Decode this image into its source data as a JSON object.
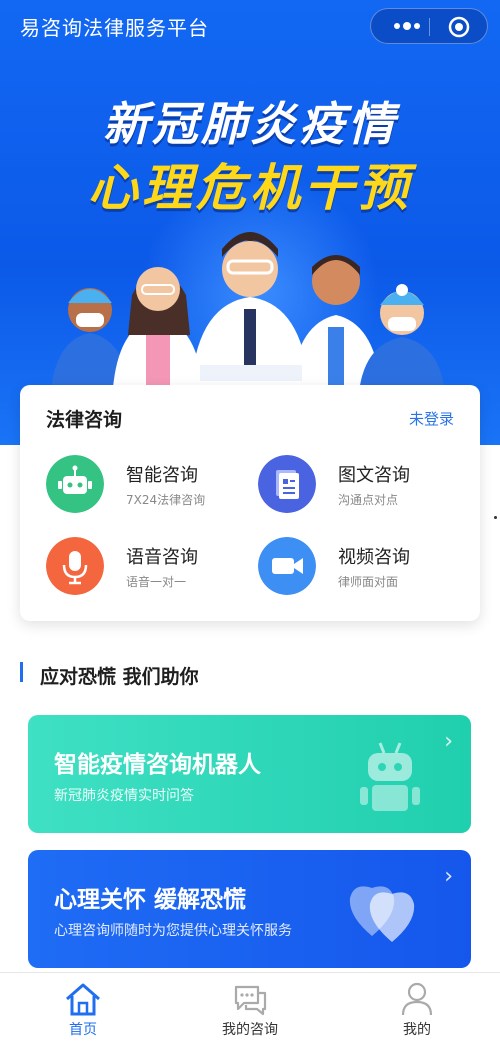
{
  "header": {
    "title": "易咨询法律服务平台",
    "more_icon": "more-dots-icon",
    "close_icon": "target-icon"
  },
  "hero": {
    "line1": "新冠肺炎疫情",
    "line2": "心理危机干预",
    "accent_color": "#ffd81a"
  },
  "legal_card": {
    "title": "法律咨询",
    "login_text": "未登录",
    "services": [
      {
        "title": "智能咨询",
        "subtitle": "7X24法律咨询",
        "icon": "robot-icon",
        "color": "#34c383"
      },
      {
        "title": "图文咨询",
        "subtitle": "沟通点对点",
        "icon": "document-icon",
        "color": "#4a63e0"
      },
      {
        "title": "语音咨询",
        "subtitle": "语音一对一",
        "icon": "microphone-icon",
        "color": "#f3663e"
      },
      {
        "title": "视频咨询",
        "subtitle": "律师面对面",
        "icon": "video-camera-icon",
        "color": "#3d8ff3"
      }
    ]
  },
  "section": {
    "title": "应对恐慌 我们助你"
  },
  "banners": [
    {
      "title": "智能疫情咨询机器人",
      "subtitle": "新冠肺炎疫情实时问答",
      "icon": "robot-icon",
      "color": "#2fd6b6"
    },
    {
      "title": "心理关怀 缓解恐慌",
      "subtitle": "心理咨询师随时为您提供心理关怀服务",
      "icon": "hearts-icon",
      "color": "#1a5ff0"
    }
  ],
  "chevron": "›",
  "tabbar": [
    {
      "label": "首页",
      "icon": "home-icon",
      "active": true
    },
    {
      "label": "我的咨询",
      "icon": "chat-bubbles-icon",
      "active": false
    },
    {
      "label": "我的",
      "icon": "user-icon",
      "active": false
    }
  ]
}
